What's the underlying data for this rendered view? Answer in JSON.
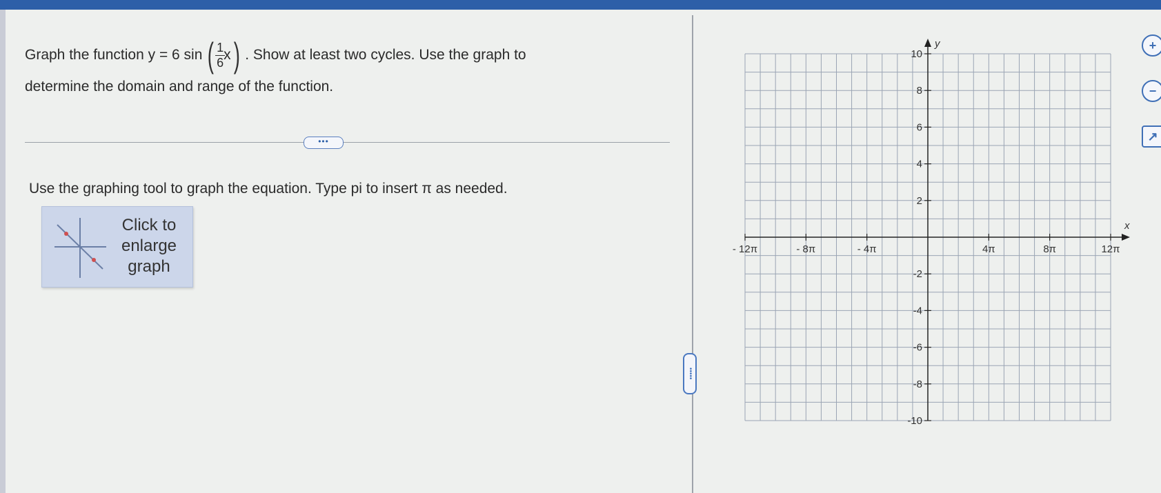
{
  "question": {
    "prefix": "Graph the function y = 6 sin",
    "frac_num": "1",
    "frac_den": "6",
    "var": "x",
    "suffix": ". Show at least two cycles. Use the graph to",
    "line2": "determine the domain and range of the function."
  },
  "more_button": "•••",
  "instruction": "Use the graphing tool to graph the equation. Type pi to insert π as needed.",
  "enlarge": {
    "label_1": "Click to",
    "label_2": "enlarge",
    "label_3": "graph"
  },
  "divider_handle": "•••••",
  "graph": {
    "x_axis_label": "x",
    "y_axis_label": "y",
    "x_tick_labels": [
      "- 12π",
      "- 8π",
      "- 4π",
      "4π",
      "8π",
      "12π"
    ],
    "y_tick_labels": [
      "10",
      "8",
      "6",
      "4",
      "2",
      "-2",
      "-4",
      "-6",
      "-8",
      "-10"
    ],
    "x_range": [
      "-12π",
      "12π"
    ],
    "y_range": [
      -10,
      10
    ],
    "grid": true
  },
  "side_icons": [
    {
      "name": "zoom-in-icon",
      "glyph": "+"
    },
    {
      "name": "zoom-out-icon",
      "glyph": "−"
    },
    {
      "name": "open-in-new-window-icon",
      "glyph": "↗"
    }
  ],
  "colors": {
    "accent": "#2d5fa8",
    "grid": "#9aa4b4",
    "background": "#eef0ee"
  }
}
